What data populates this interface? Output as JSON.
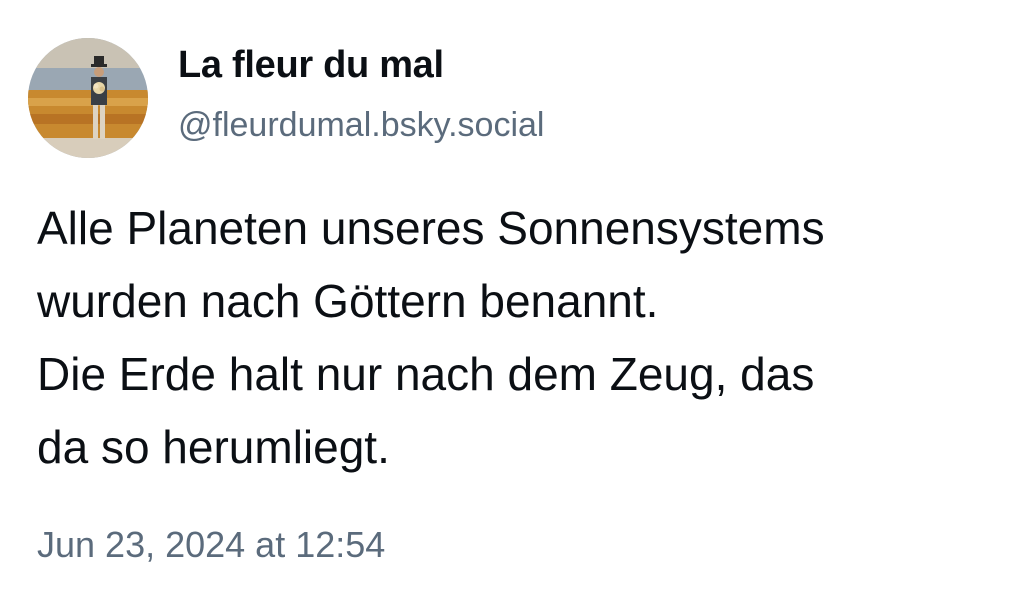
{
  "author": {
    "display_name": "La fleur du mal",
    "handle": "@fleurdumal.bsky.social"
  },
  "post": {
    "lines": [
      "Alle Planeten unseres Sonnensystems",
      "wurden nach Göttern benannt.",
      "Die Erde halt nur nach dem Zeug, das",
      "da so herumliegt."
    ],
    "timestamp": "Jun 23, 2024 at 12:54"
  },
  "colors": {
    "text": "#0b0f14",
    "secondary_text": "#5b6b7c",
    "background": "#ffffff"
  }
}
